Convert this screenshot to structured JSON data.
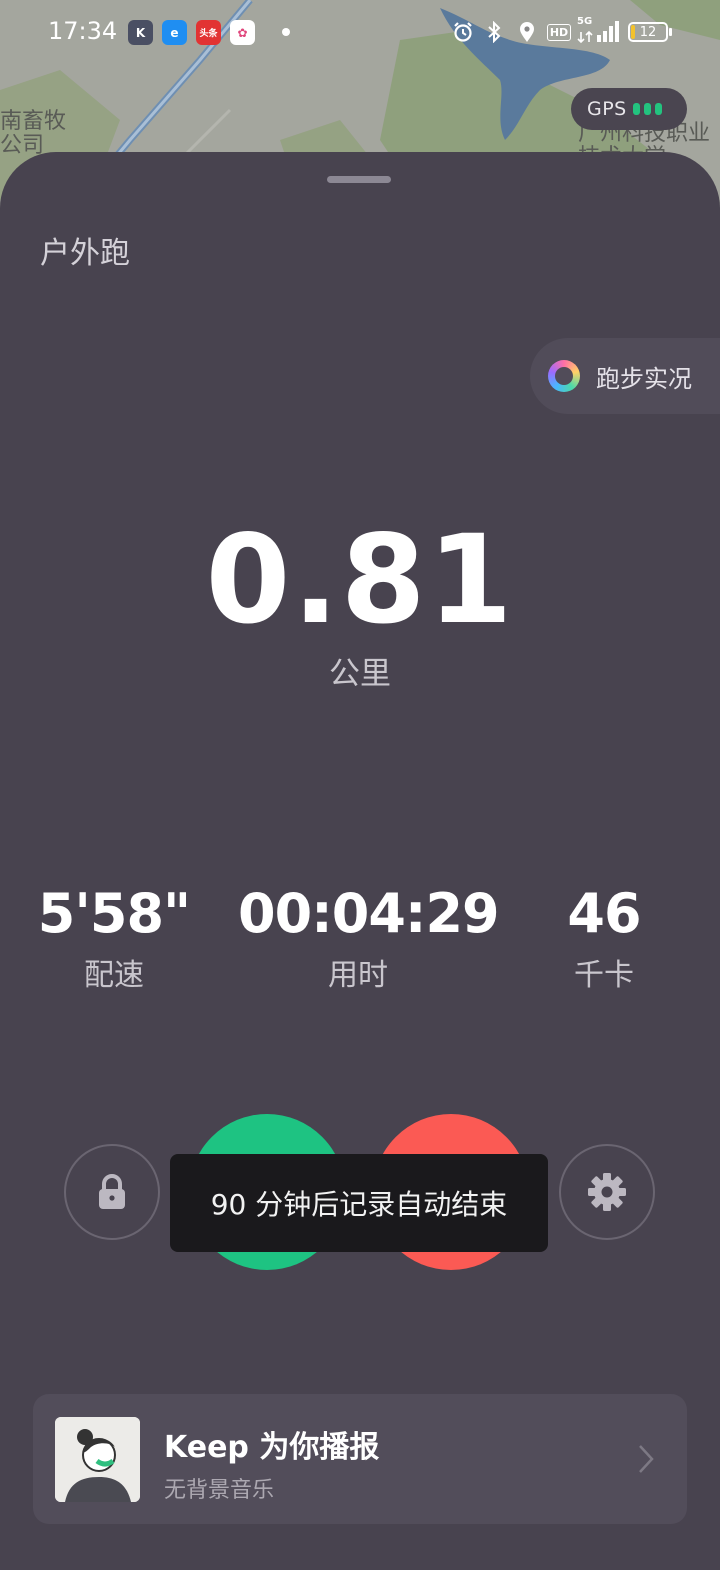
{
  "status_bar": {
    "time": "17:34",
    "notifications": [
      {
        "name": "keep-app-icon",
        "glyph": "K",
        "color": "#4a4f63"
      },
      {
        "name": "browser-app-icon",
        "glyph": "e",
        "color": "#1f8ef2"
      },
      {
        "name": "toutiao-app-icon",
        "glyph": "头条",
        "color": "#e23333"
      },
      {
        "name": "gallery-app-icon",
        "glyph": "✿",
        "color": "#ffffff"
      }
    ],
    "network": "5G",
    "hd_badge": "HD",
    "battery_level": "12",
    "battery_fraction": 0.12
  },
  "map": {
    "labels": [
      "南畜牧\n公司",
      "广州科技职业\n技术大学"
    ]
  },
  "gps": {
    "label": "GPS",
    "signal_bars": 3,
    "color": "#23c37f"
  },
  "workout": {
    "mode_title": "户外跑",
    "live_button": "跑步实况",
    "distance": "0.81",
    "distance_unit": "公里",
    "stats": [
      {
        "value": "5'58\"",
        "label": "配速"
      },
      {
        "value": "00:04:29",
        "label": "用时"
      },
      {
        "value": "46",
        "label": "千卡"
      }
    ]
  },
  "controls": {
    "resume_color": "#1ec382",
    "stop_color": "#fb5a54"
  },
  "toast": "90 分钟后记录自动结束",
  "announcer": {
    "title": "Keep 为你播报",
    "subtitle": "无背景音乐"
  }
}
